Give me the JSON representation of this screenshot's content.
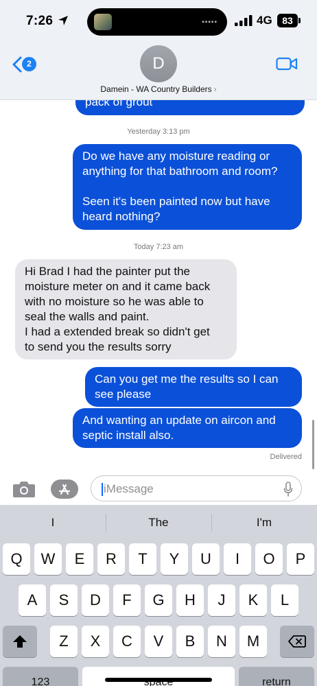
{
  "status": {
    "time": "7:26",
    "network": "4G",
    "battery": "83"
  },
  "nav": {
    "back_badge": "2",
    "avatar_initial": "D",
    "contact_name": "Damein - WA Country Builders",
    "contact_chevron": "›"
  },
  "thread": {
    "top_partial": "pack of grout",
    "stamp1": "Yesterday 3:13 pm",
    "msg_out_1_line1": "Do we have any moisture reading or",
    "msg_out_1_line2": "anything for that bathroom and room?",
    "msg_out_1_line3": "Seen it's been painted now but have",
    "msg_out_1_line4": "heard nothing?",
    "stamp2": "Today 7:23 am",
    "msg_in_1_line1": "Hi Brad I had the painter put the",
    "msg_in_1_line2": "moisture meter on and it came back",
    "msg_in_1_line3": "with no moisture so he was able to",
    "msg_in_1_line4": "seal the walls and paint.",
    "msg_in_1_line5": "I had a extended break so didn't get",
    "msg_in_1_line6": "to send you the results sorry",
    "msg_out_2_line1": "Can you get me the results so I can",
    "msg_out_2_line2": "see please",
    "msg_out_3_line1": "And wanting an update on aircon and",
    "msg_out_3_line2": "septic install also.",
    "delivered": "Delivered"
  },
  "input": {
    "placeholder": "iMessage"
  },
  "keyboard": {
    "suggestions": [
      "I",
      "The",
      "I'm"
    ],
    "row1": [
      "Q",
      "W",
      "E",
      "R",
      "T",
      "Y",
      "U",
      "I",
      "O",
      "P"
    ],
    "row2": [
      "A",
      "S",
      "D",
      "F",
      "G",
      "H",
      "J",
      "K",
      "L"
    ],
    "row3": [
      "Z",
      "X",
      "C",
      "V",
      "B",
      "N",
      "M"
    ],
    "numbers_key": "123",
    "space_key": "space",
    "return_key": "return"
  },
  "colors": {
    "outgoing_bubble": "#0b50d8",
    "incoming_bubble": "#e5e5ea",
    "accent": "#1c82f5"
  }
}
